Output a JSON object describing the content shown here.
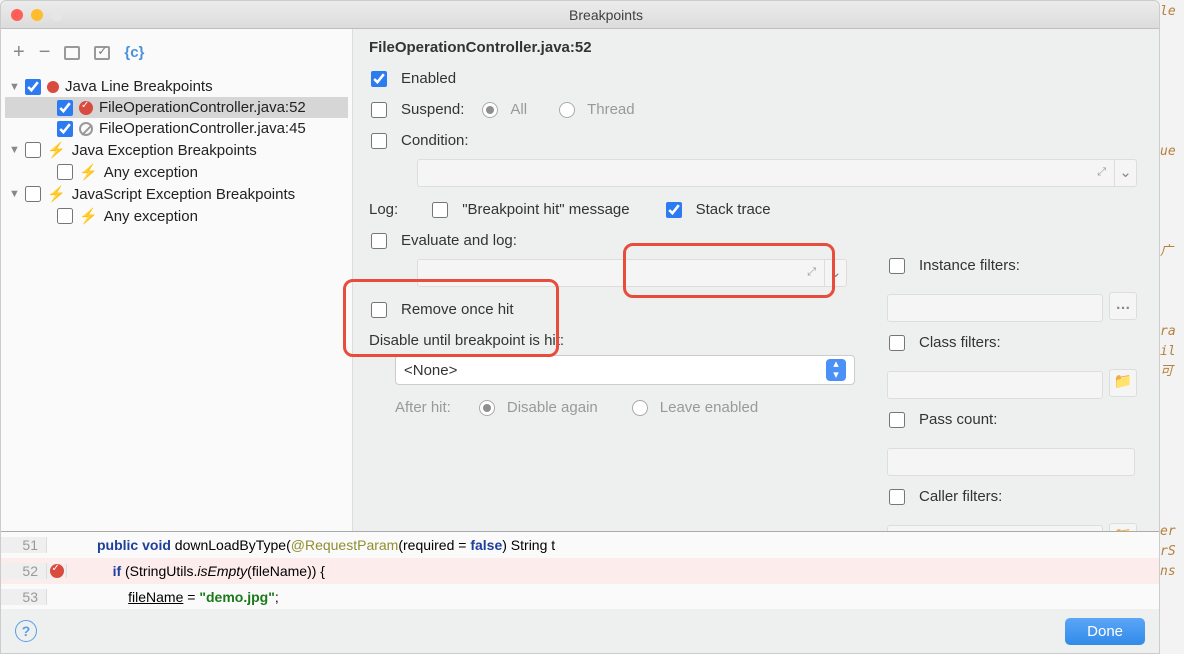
{
  "window": {
    "title": "Breakpoints"
  },
  "tree": {
    "group1": {
      "label": "Java Line Breakpoints"
    },
    "bp1": {
      "label": "FileOperationController.java:52"
    },
    "bp2": {
      "label": "FileOperationController.java:45"
    },
    "group2": {
      "label": "Java Exception Breakpoints"
    },
    "any1": {
      "label": "Any exception"
    },
    "group3": {
      "label": "JavaScript Exception Breakpoints"
    },
    "any2": {
      "label": "Any exception"
    }
  },
  "detail": {
    "title": "FileOperationController.java:52",
    "enabled": "Enabled",
    "suspend": "Suspend:",
    "all": "All",
    "thread": "Thread",
    "condition": "Condition:",
    "log": "Log:",
    "bpmsg": "\"Breakpoint hit\" message",
    "stacktrace": "Stack trace",
    "evalLog": "Evaluate and log:",
    "removeOnce": "Remove once hit",
    "disableUntil": "Disable until breakpoint is hit:",
    "none": "<None>",
    "afterHit": "After hit:",
    "disableAgain": "Disable again",
    "leaveEnabled": "Leave enabled",
    "instanceFilters": "Instance filters:",
    "classFilters": "Class filters:",
    "passCount": "Pass count:",
    "callerFilters": "Caller filters:"
  },
  "code": {
    "l51_num": "51",
    "l52_num": "52",
    "l53_num": "53",
    "l51_a": "public void",
    "l51_b": " downLoadByType(",
    "l51_c": "@RequestParam",
    "l51_d": "(required = ",
    "l51_e": "false",
    "l51_f": ") String t",
    "l52_a": "if ",
    "l52_b": "(StringUtils.",
    "l52_c": "isEmpty",
    "l52_d": "(fileName)) {",
    "l53_a": "fileName",
    "l53_b": " = ",
    "l53_c": "\"demo.jpg\"",
    "l53_d": ";"
  },
  "footer": {
    "done": "Done",
    "help": "?"
  }
}
